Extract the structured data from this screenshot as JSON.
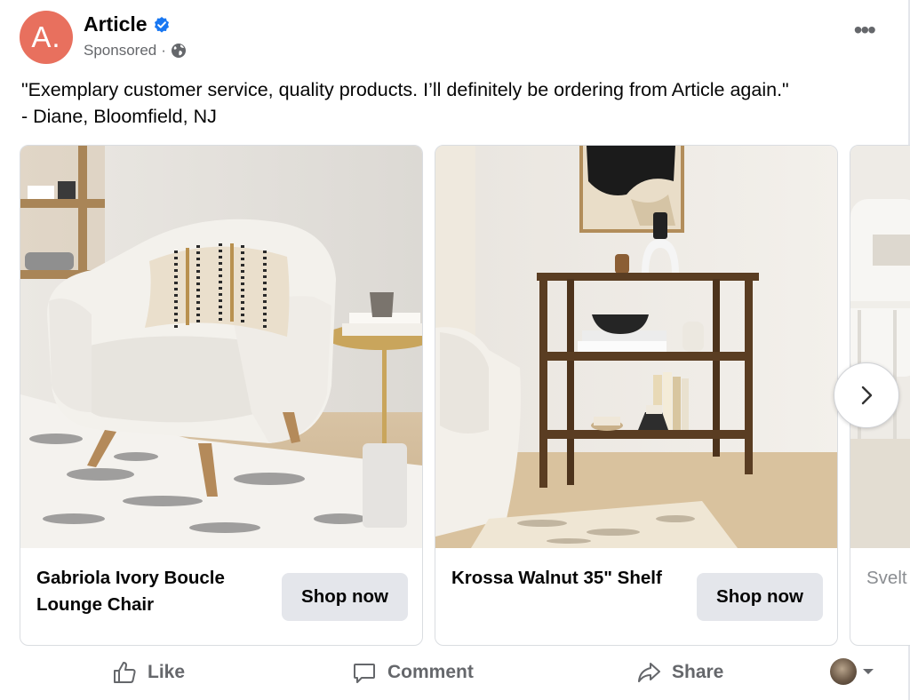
{
  "post": {
    "author_initial": "A.",
    "author_name": "Article",
    "sponsored_label": "Sponsored",
    "separator": "·",
    "text_line1": "\"Exemplary customer service, quality products. I’ll definitely be ordering from Article again.\"",
    "text_line2": "- Diane, Bloomfield, NJ"
  },
  "carousel": {
    "cards": [
      {
        "title": "Gabriola Ivory Boucle Lounge Chair",
        "cta": "Shop now"
      },
      {
        "title": "Krossa Walnut 35\" Shelf",
        "cta": "Shop now"
      },
      {
        "title": "Svelt Dinin",
        "cta": ""
      }
    ]
  },
  "actions": {
    "like": "Like",
    "comment": "Comment",
    "share": "Share"
  },
  "colors": {
    "avatar": "#e8705e",
    "verified": "#1877f2",
    "secondary_text": "#65676b",
    "button_bg": "#e4e6eb"
  }
}
